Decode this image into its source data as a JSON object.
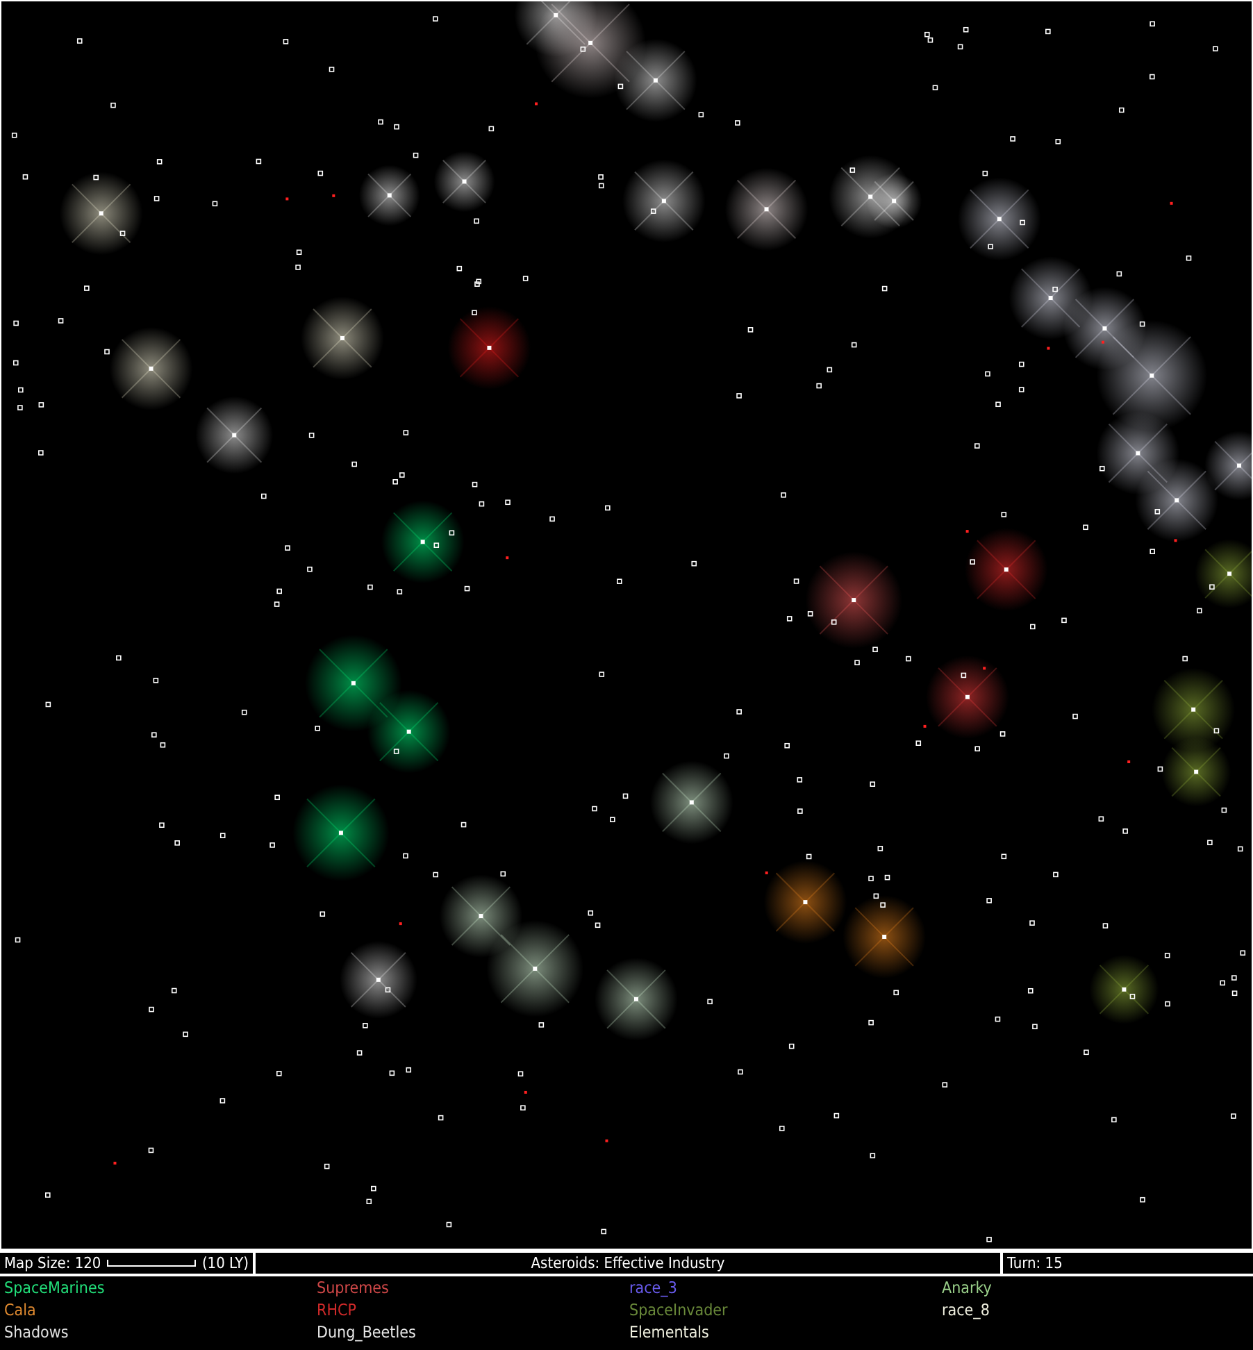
{
  "status_bar": {
    "map_size": "Map Size: 120",
    "scale_label": "(10 LY)",
    "message": "Asteroids: Effective Industry",
    "turn": "Turn: 15"
  },
  "races": [
    {
      "name": "SpaceMarines",
      "color": "#22e07a"
    },
    {
      "name": "Supremes",
      "color": "#d04848"
    },
    {
      "name": "race_3",
      "color": "#6a5cf0"
    },
    {
      "name": "Anarky",
      "color": "#9ad08a"
    },
    {
      "name": "Cala",
      "color": "#e08a30"
    },
    {
      "name": "RHCP",
      "color": "#d02a2a"
    },
    {
      "name": "SpaceInvader",
      "color": "#6a8a3a"
    },
    {
      "name": "race_8",
      "color": "#f0f0e0"
    },
    {
      "name": "Shadows",
      "color": "#e0e0e0"
    },
    {
      "name": "Dung_Beetles",
      "color": "#e8e8e8"
    },
    {
      "name": "Elementals",
      "color": "#f0f0e0"
    }
  ]
}
